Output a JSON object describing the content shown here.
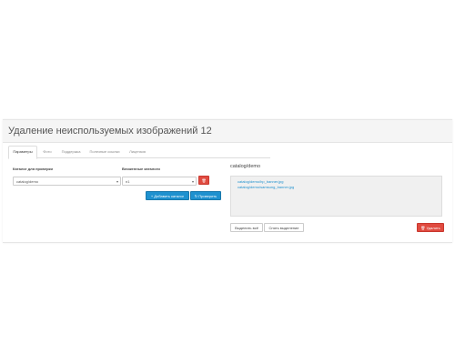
{
  "page": {
    "title": "Удаление неиспользуемых изображений 12"
  },
  "tabs": [
    {
      "label": "Параметры",
      "active": true
    },
    {
      "label": "Фото",
      "active": false
    },
    {
      "label": "Поддержка",
      "active": false
    },
    {
      "label": "Полезные ссылки",
      "active": false
    },
    {
      "label": "Лицензия",
      "active": false
    }
  ],
  "form": {
    "catalog_label": "Каталог для проверки",
    "catalog_value": "catalog/demo",
    "nested_label": "Вложенные каталоги",
    "nested_value": "n1",
    "add_catalog_label": "Добавить каталог",
    "check_label": "Проверить"
  },
  "results": {
    "title": "catalog/demo",
    "files": [
      "catalog/demo/hp_banner.jpg",
      "catalog/demo/samsung_banner.jpg"
    ],
    "select_all_label": "Выделить всё",
    "clear_selection_label": "Снять выделение",
    "delete_label": "Удалить"
  },
  "colors": {
    "primary": "#1e91cf",
    "danger": "#e04b40",
    "header_bg": "#f5f5f5",
    "results_bg": "#f0f0f0"
  }
}
